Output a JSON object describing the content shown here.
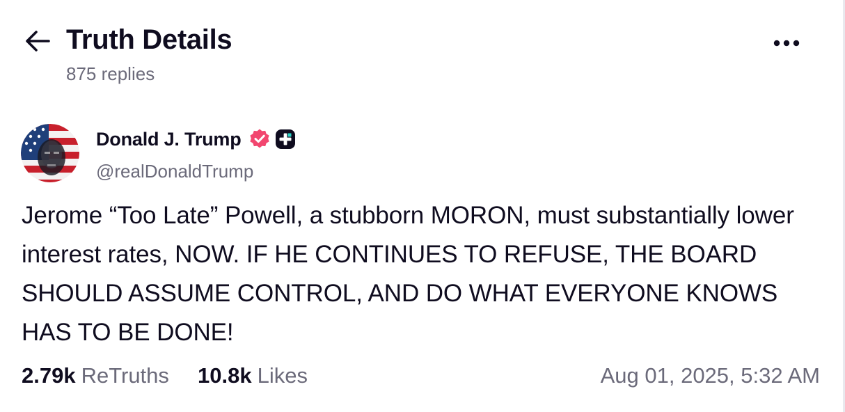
{
  "header": {
    "title": "Truth Details",
    "reply_count": "875 replies",
    "back_icon": "arrow-left-icon",
    "more_icon": "ellipsis-horizontal-icon"
  },
  "post": {
    "author": {
      "name": "Donald J. Trump",
      "handle": "@realDonaldTrump",
      "verified_icon": "verified-badge-icon",
      "verified_color": "#f2466f",
      "plus_icon": "plus-badge-icon"
    },
    "text": "Jerome “Too Late” Powell, a stubborn MORON, must substantially lower interest rates, NOW. IF HE CONTINUES TO REFUSE, THE BOARD SHOULD ASSUME CONTROL, AND DO WHAT EVERYONE KNOWS HAS TO BE DONE!",
    "stats": {
      "retruths_count": "2.79k",
      "retruths_label": "ReTruths",
      "likes_count": "10.8k",
      "likes_label": "Likes"
    },
    "timestamp": "Aug 01, 2025, 5:32 AM"
  },
  "colors": {
    "text_primary": "#0f0c1f",
    "text_secondary": "#6b6a7a",
    "background": "#ffffff"
  }
}
